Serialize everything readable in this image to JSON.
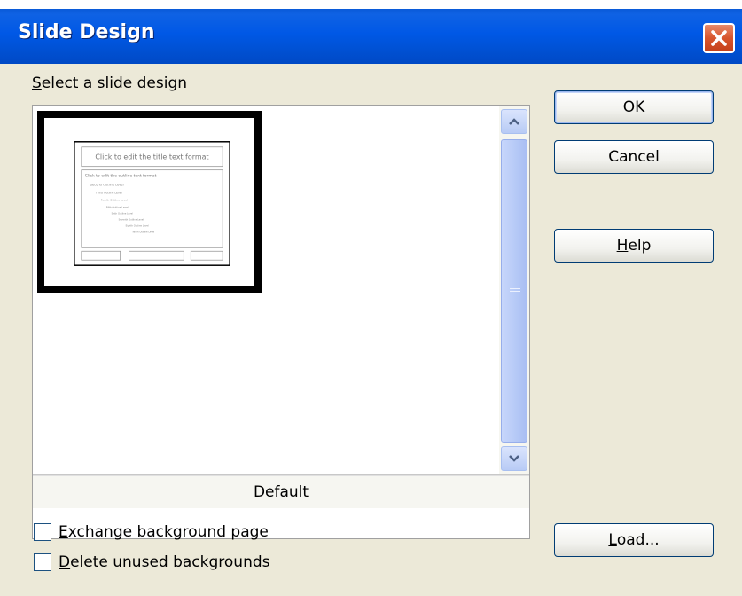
{
  "dialog": {
    "title": "Slide Design"
  },
  "designs": {
    "prompt_label": "Select a slide design",
    "prompt_mnemonic": "S",
    "prompt_rest": "elect a slide design",
    "selected_caption": "Default",
    "thumbnail": {
      "title_text": "Click to edit the title text format",
      "outline_text": "Click to edit the outline text format",
      "levels": [
        "Second Outline Level",
        "Third Outline Level",
        "Fourth Outline Level",
        "Fifth Outline Level",
        "Sixth Outline Level",
        "Seventh Outline Level",
        "Eighth Outline Level",
        "Ninth Outline Level"
      ]
    }
  },
  "buttons": {
    "ok": "OK",
    "cancel": "Cancel",
    "help_mnemonic": "H",
    "help_rest": "elp",
    "load_mnemonic": "L",
    "load_rest": "oad..."
  },
  "options": {
    "exchange_mnemonic": "E",
    "exchange_rest": "xchange background page",
    "exchange_checked": false,
    "delete_mnemonic": "D",
    "delete_rest": "elete unused backgrounds",
    "delete_checked": false
  },
  "colors": {
    "titlebar": "#0058e6",
    "dialog_bg": "#ece9d8",
    "close": "#d8552d"
  }
}
